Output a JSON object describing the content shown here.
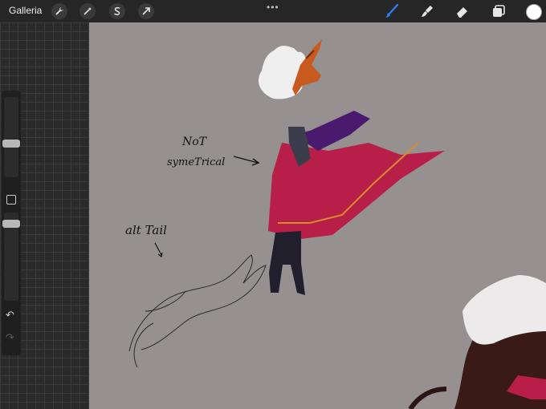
{
  "toolbar": {
    "gallery_label": "Galleria",
    "left_icons": [
      "wrench-icon",
      "magic-wand-icon",
      "selection-s-icon",
      "arrow-transform-icon"
    ],
    "more_label": "•••",
    "right_icons": [
      "brush-icon",
      "smudge-icon",
      "eraser-icon",
      "layers-icon"
    ],
    "active_tool": "brush",
    "current_color": "#ffffff",
    "accent": "#2f7bf6"
  },
  "sidebar": {
    "brush_size_level": 0.4,
    "opacity_level": 0.85,
    "undo_label": "↶",
    "redo_label": "↷"
  },
  "canvas": {
    "background": "#969190",
    "annotations": {
      "note1_line1": "NoT",
      "note1_line2": "symeTrical",
      "note2": "alt Tail"
    }
  }
}
